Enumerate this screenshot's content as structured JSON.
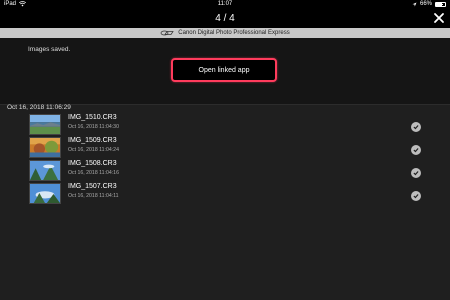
{
  "status_bar": {
    "device": "iPad",
    "wifi_icon": "wifi-icon",
    "time": "11:07",
    "location_icon": "location-arrow-icon",
    "battery_percent": "66%",
    "battery_level": 0.66
  },
  "nav": {
    "title": "4 / 4",
    "close_icon": "close-icon"
  },
  "banner": {
    "logo_icon": "canon-dpp-logo-icon",
    "label": "Canon Digital Photo Professional Express"
  },
  "top_panel": {
    "message": "Images saved.",
    "open_button_label": "Open linked app"
  },
  "date_group": "Oct 16, 2018 11:06:29",
  "images": [
    {
      "name": "IMG_1510.CR3",
      "timestamp": "Oct 16, 2018 11:04:30",
      "thumb_icon": "landscape-thumbnail-icon",
      "saved": true
    },
    {
      "name": "IMG_1509.CR3",
      "timestamp": "Oct 16, 2018 11:04:24",
      "thumb_icon": "autumn-thumbnail-icon",
      "saved": true
    },
    {
      "name": "IMG_1508.CR3",
      "timestamp": "Oct 16, 2018 11:04:16",
      "thumb_icon": "sky-thumbnail-icon",
      "saved": true
    },
    {
      "name": "IMG_1507.CR3",
      "timestamp": "Oct 16, 2018 11:04:11",
      "thumb_icon": "sky-thumbnail-icon",
      "saved": true
    }
  ],
  "colors": {
    "highlight_border": "#ff3b5c",
    "background": "#1f1f1f",
    "check": "#bdbdbd"
  }
}
